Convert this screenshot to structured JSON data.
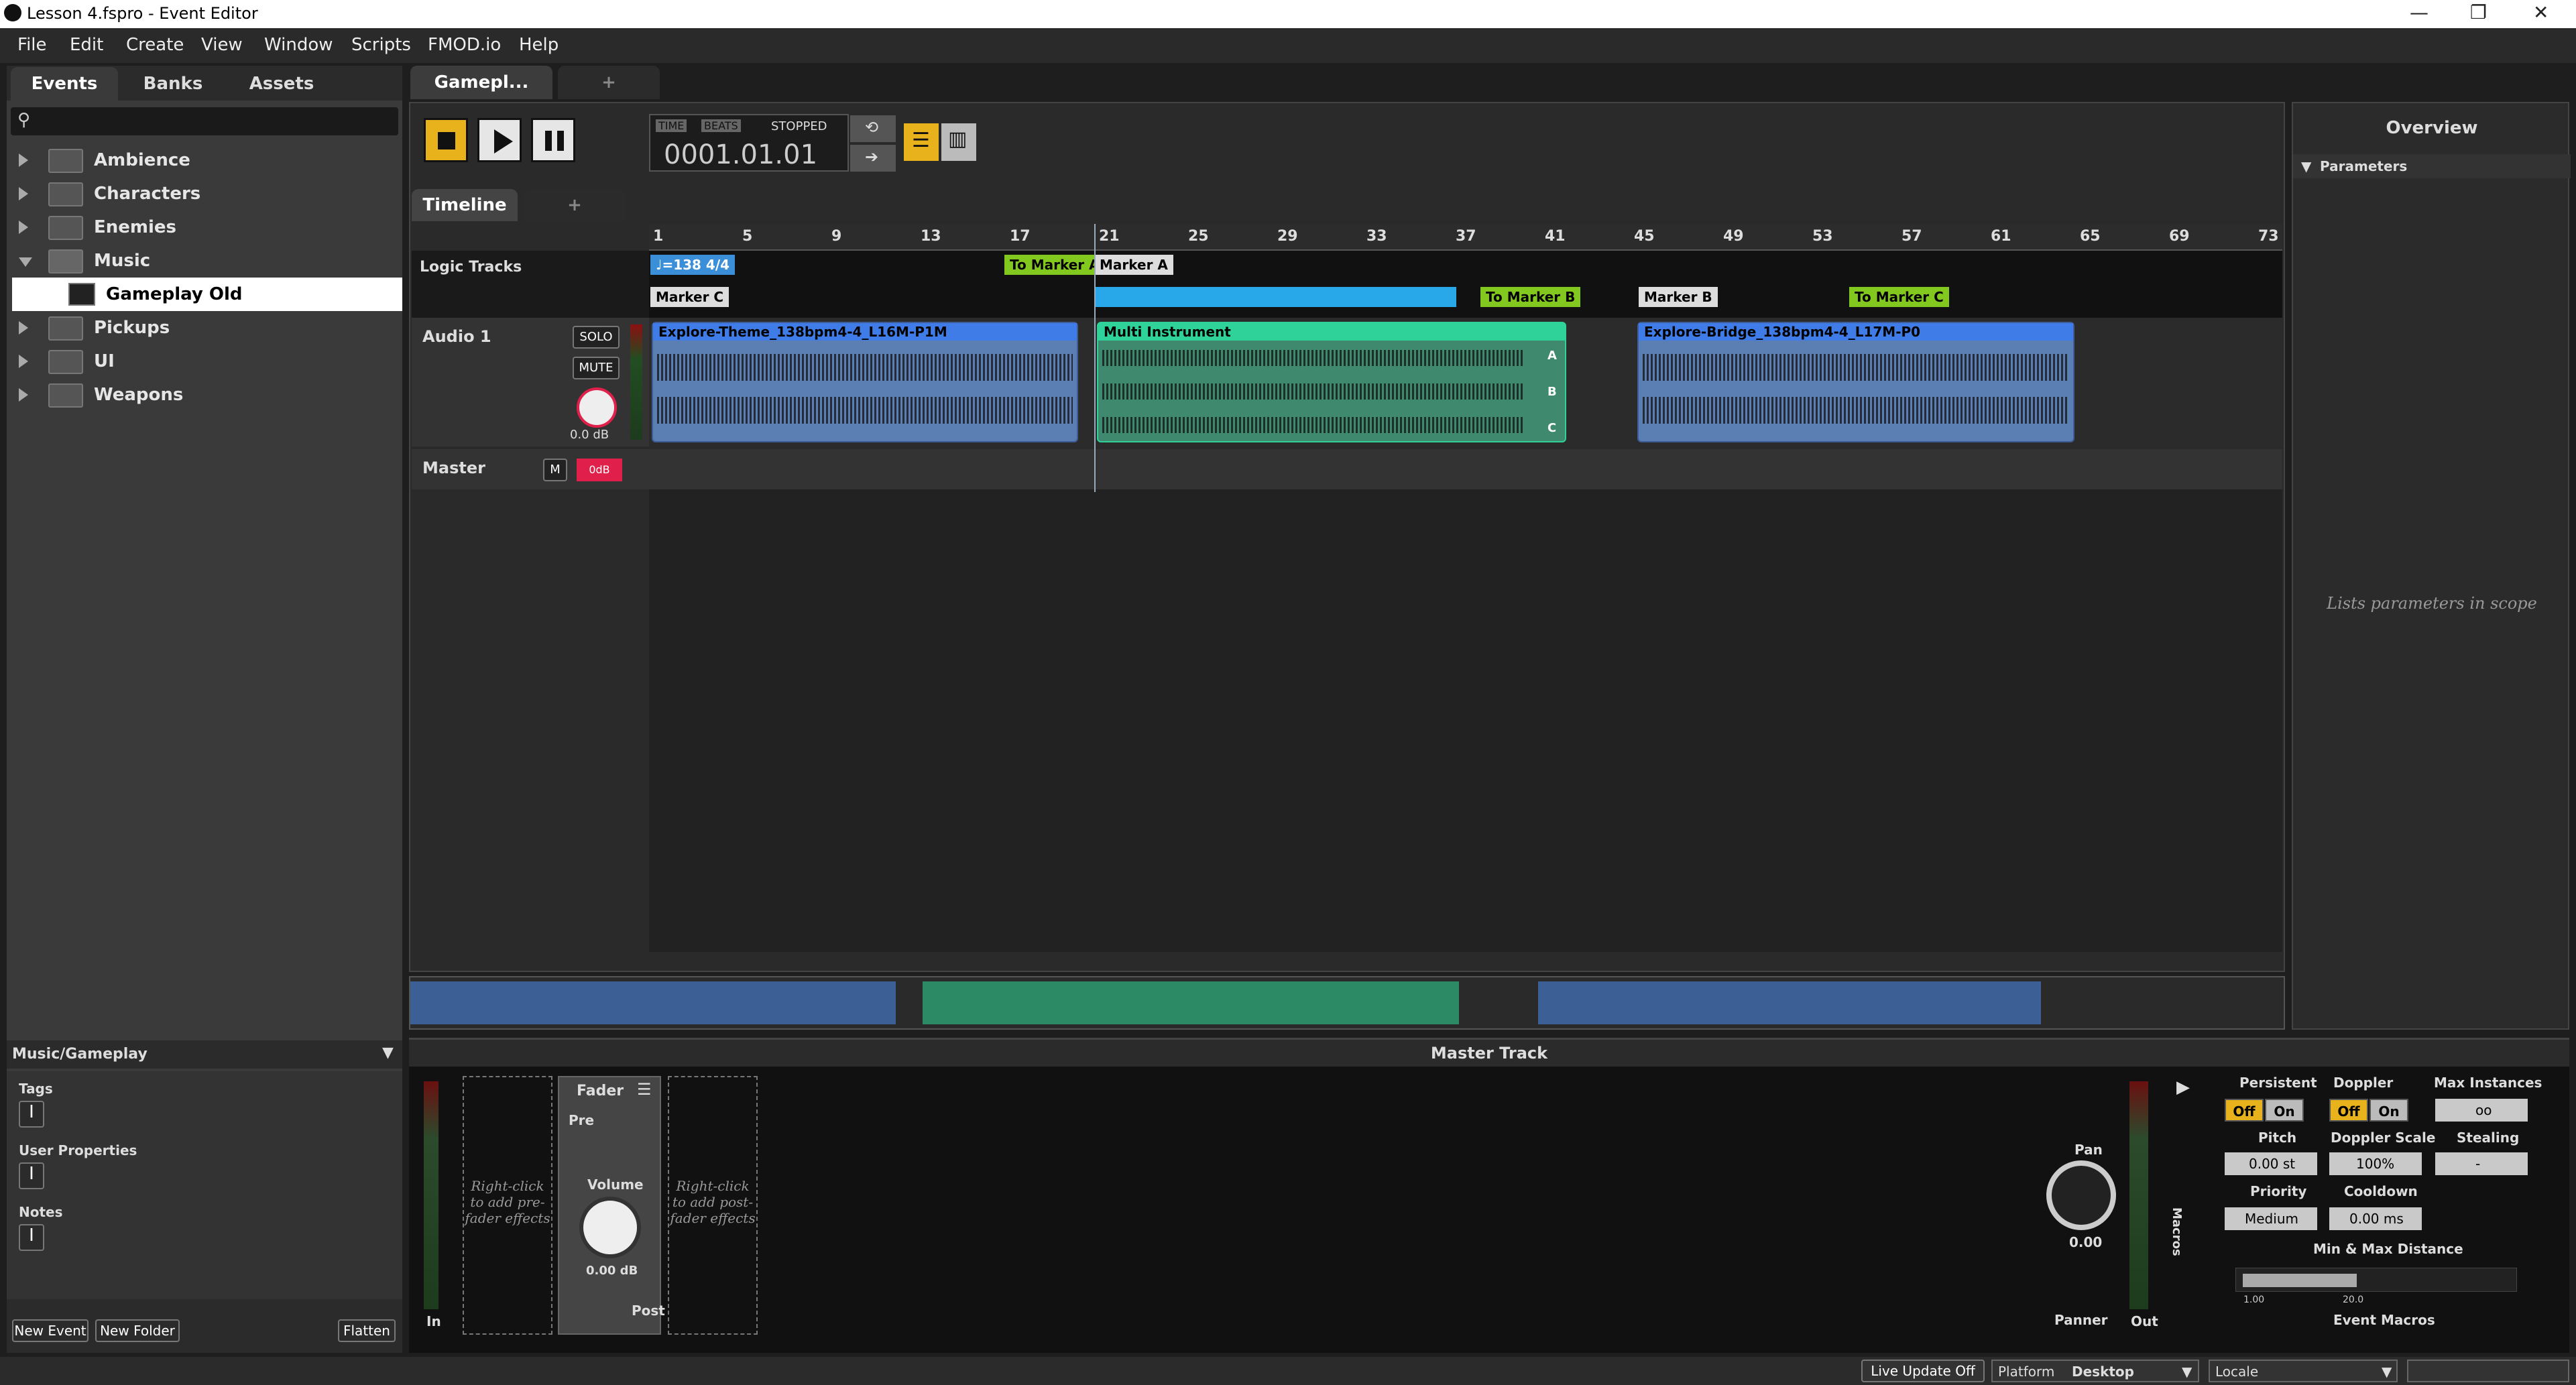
{
  "window": {
    "title": "Lesson 4.fspro - Event Editor",
    "minimize": "—",
    "restore": "❐",
    "close": "✕"
  },
  "menu": [
    "File",
    "Edit",
    "Create",
    "View",
    "Window",
    "Scripts",
    "FMOD.io",
    "Help"
  ],
  "browser": {
    "tabs": [
      "Events",
      "Banks",
      "Assets"
    ],
    "search_placeholder": "",
    "tree": [
      {
        "label": "Ambience",
        "expanded": false
      },
      {
        "label": "Characters",
        "expanded": false
      },
      {
        "label": "Enemies",
        "expanded": false
      },
      {
        "label": "Music",
        "expanded": true
      },
      {
        "label": "Gameplay Old",
        "child": true
      },
      {
        "label": "Pickups",
        "expanded": false
      },
      {
        "label": "UI",
        "expanded": false
      },
      {
        "label": "Weapons",
        "expanded": false
      }
    ],
    "path_label": "Music/Gameplay",
    "tags_label": "Tags",
    "user_props_label": "User Properties",
    "notes_label": "Notes",
    "new_event": "New Event",
    "new_folder": "New Folder",
    "flatten": "Flatten"
  },
  "editor": {
    "event_tab": "Gamepl...",
    "add_tab": "+",
    "time_label": "TIME",
    "beats_label": "BEATS",
    "state": "STOPPED",
    "position": "0001.01.01",
    "timeline_tab": "Timeline",
    "timeline_add": "+"
  },
  "timeline": {
    "ruler": [
      "1",
      "5",
      "9",
      "13",
      "17",
      "21",
      "25",
      "29",
      "33",
      "37",
      "41",
      "45",
      "49",
      "53",
      "57",
      "61",
      "65",
      "69",
      "73"
    ],
    "logic_tracks_label": "Logic Tracks",
    "tempo_marker": "=138 4/4",
    "markers": {
      "marker_c": "Marker C",
      "to_marker_a": "To Marker A",
      "marker_a": "Marker A",
      "to_marker_b": "To Marker B",
      "marker_b": "Marker B",
      "to_marker_c": "To Marker C"
    },
    "audio_track": {
      "name": "Audio 1",
      "solo": "SOLO",
      "mute": "MUTE",
      "volume": "0.0 dB"
    },
    "master_track": {
      "name": "Master",
      "m": "M",
      "vol": "0dB"
    },
    "clips": [
      {
        "name": "Explore-Theme_138bpm4-4_L16M-P1M"
      },
      {
        "name": "Multi Instrument",
        "rows": [
          "A",
          "B",
          "C"
        ]
      },
      {
        "name": "Explore-Bridge_138bpm4-4_L17M-P0"
      }
    ]
  },
  "overview": {
    "title": "Overview",
    "parameters": "Parameters",
    "empty_hint": "Lists parameters in scope"
  },
  "deck": {
    "title": "Master Track",
    "pre_fx_hint": "Right-click to add pre-fader effects",
    "post_fx_hint": "Right-click to add post-fader effects",
    "fader_title": "Fader",
    "pre": "Pre",
    "post": "Post",
    "volume_label": "Volume",
    "volume_value": "0.00 dB",
    "in_label": "In",
    "pan_label": "Pan",
    "pan_value": "0.00",
    "panner_label": "Panner",
    "out_label": "Out",
    "macros_label": "Macros"
  },
  "macros": {
    "persistent": "Persistent",
    "doppler": "Doppler",
    "max_instances": "Max Instances",
    "off": "Off",
    "on": "On",
    "max_instances_value": "oo",
    "pitch": "Pitch",
    "pitch_value": "0.00 st",
    "doppler_scale": "Doppler Scale",
    "doppler_scale_value": "100%",
    "stealing": "Stealing",
    "stealing_value": "-",
    "priority": "Priority",
    "priority_value": "Medium",
    "cooldown": "Cooldown",
    "cooldown_value": "0.00 ms",
    "distance": "Min & Max Distance",
    "dist_min": "1.00",
    "dist_max": "20.0",
    "footer": "Event Macros"
  },
  "statusbar": {
    "live_update": "Live Update Off",
    "platform_label": "Platform",
    "platform_value": "Desktop",
    "locale_label": "Locale"
  },
  "colors": {
    "accent": "#e8b21c",
    "clip_blue": "#4a78c2",
    "clip_green": "#2fd39a",
    "marker_green": "#82c81e",
    "master_red": "#e0204a"
  }
}
